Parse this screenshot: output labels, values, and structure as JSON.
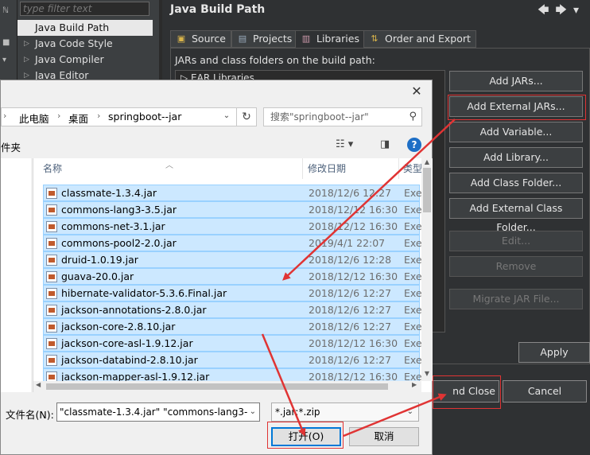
{
  "sidebar": {
    "filter_placeholder": "type filter text",
    "items": [
      {
        "label": "Java Build Path",
        "selected": true
      },
      {
        "label": "Java Code Style",
        "selected": false
      },
      {
        "label": "Java Compiler",
        "selected": false
      },
      {
        "label": "Java Editor",
        "selected": false
      }
    ]
  },
  "eclipse": {
    "title": "Java Build Path",
    "tabs": [
      {
        "label": "Source",
        "icon": "source-folder-icon"
      },
      {
        "label": "Projects",
        "icon": "projects-icon"
      },
      {
        "label": "Libraries",
        "icon": "libraries-icon",
        "active": true
      },
      {
        "label": "Order and Export",
        "icon": "order-export-icon"
      }
    ],
    "jars_label": "JARs and class folders on the build path:",
    "library_row": "EAR Libraries",
    "buttons": {
      "add_jars": "Add JARs...",
      "add_external_jars": "Add External JARs...",
      "add_variable": "Add Variable...",
      "add_library": "Add Library...",
      "add_class_folder": "Add Class Folder...",
      "add_external_class_folder": "Add External Class Folder...",
      "edit": "Edit...",
      "remove": "Remove",
      "migrate": "Migrate JAR File..."
    },
    "apply_label": "Apply",
    "apply_close_label": "Apply and Close",
    "apply_close_visible": "nd Close",
    "cancel_label": "Cancel"
  },
  "dialog": {
    "breadcrumb": [
      "此电脑",
      "桌面",
      "springboot--jar"
    ],
    "search_placeholder": "搜索\"springboot--jar\"",
    "toolbar_fragment": "件夹",
    "columns": {
      "name": "名称",
      "date": "修改日期",
      "type": "类型"
    },
    "files": [
      {
        "name": "classmate-1.3.4.jar",
        "date": "2018/12/6 12:27",
        "type": "Exe"
      },
      {
        "name": "commons-lang3-3.5.jar",
        "date": "2018/12/12 16:30",
        "type": "Exe"
      },
      {
        "name": "commons-net-3.1.jar",
        "date": "2018/12/12 16:30",
        "type": "Exe"
      },
      {
        "name": "commons-pool2-2.0.jar",
        "date": "2019/4/1 22:07",
        "type": "Exe"
      },
      {
        "name": "druid-1.0.19.jar",
        "date": "2018/12/6 12:28",
        "type": "Exe"
      },
      {
        "name": "guava-20.0.jar",
        "date": "2018/12/12 16:30",
        "type": "Exe"
      },
      {
        "name": "hibernate-validator-5.3.6.Final.jar",
        "date": "2018/12/6 12:27",
        "type": "Exe"
      },
      {
        "name": "jackson-annotations-2.8.0.jar",
        "date": "2018/12/6 12:27",
        "type": "Exe"
      },
      {
        "name": "jackson-core-2.8.10.jar",
        "date": "2018/12/6 12:27",
        "type": "Exe"
      },
      {
        "name": "jackson-core-asl-1.9.12.jar",
        "date": "2018/12/12 16:30",
        "type": "Exe"
      },
      {
        "name": "jackson-databind-2.8.10.jar",
        "date": "2018/12/6 12:27",
        "type": "Exe"
      },
      {
        "name": "jackson-mapper-asl-1.9.12.jar",
        "date": "2018/12/12 16:30",
        "type": "Exe"
      }
    ],
    "filename_label": "文件名(N):",
    "filename_value": "\"classmate-1.3.4.jar\" \"commons-lang3-3.",
    "filter_value": "*.jar;*.zip",
    "open_label": "打开(O)",
    "cancel_label": "取消"
  },
  "colors": {
    "annotation": "#e03434",
    "selection": "#cce8ff",
    "accent": "#0078d7"
  }
}
